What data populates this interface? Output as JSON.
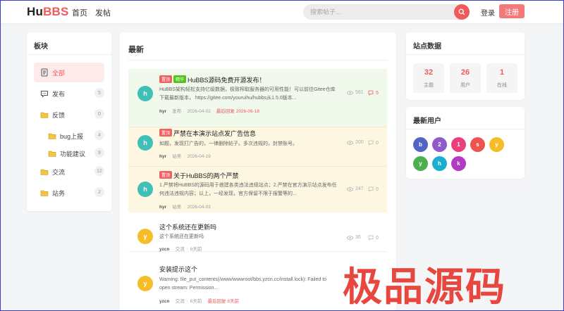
{
  "header": {
    "logo_hu": "Hu",
    "logo_bbs": "BBS",
    "nav": [
      "首页",
      "发帖"
    ],
    "search_placeholder": "搜索帖子...",
    "login": "登录",
    "register": "注册",
    "accent": "#ef5a5a"
  },
  "sidebar": {
    "title": "板块",
    "items": [
      {
        "label": "全部",
        "count": "",
        "active": true,
        "icon": "document-icon"
      },
      {
        "label": "发布",
        "count": "5",
        "icon": "chat-icon"
      },
      {
        "label": "反馈",
        "count": "0",
        "icon": "folder-icon"
      },
      {
        "label": "bug上报",
        "count": "4",
        "icon": "folder-icon"
      },
      {
        "label": "功能建议",
        "count": "9",
        "icon": "folder-icon"
      },
      {
        "label": "交流",
        "count": "12",
        "icon": "folder-icon"
      },
      {
        "label": "站务",
        "count": "2",
        "icon": "folder-icon"
      }
    ]
  },
  "main": {
    "title": "最新",
    "topics": [
      {
        "avatar": "h",
        "avatar_color": "#3fbfb6",
        "bg": "#f0f9ec",
        "tags": [
          {
            "text": "置顶",
            "color": "#f06262"
          },
          {
            "text": "精华",
            "color": "#52c41a"
          }
        ],
        "title": "HuBBS源码免费开源发布！",
        "summary": "HuBBS架构轻松支持亿级数据，极致榨取服务器的可用性能！可以前往Gitee仓库下载最新版本， https://gitee.com/youruihu/hubbs从1.5.0版本...",
        "author": "hyr",
        "board": "发布",
        "date": "2026-04-02",
        "last_reply_label": "最后回复",
        "last_reply": "2026-06-18",
        "views": "561",
        "replies": "5"
      },
      {
        "avatar": "h",
        "avatar_color": "#3fbfb6",
        "bg": "#fdf7e2",
        "tags": [
          {
            "text": "置顶",
            "color": "#f06262"
          }
        ],
        "title": "严禁在本演示站点发广告信息",
        "summary": "如题，发现打广告的，一律删除帖子。多次违规的，封禁账号。",
        "author": "hyr",
        "board": "站务",
        "date": "2026-04-19",
        "last_reply_label": "",
        "last_reply": "",
        "views": "200",
        "replies": "0"
      },
      {
        "avatar": "h",
        "avatar_color": "#3fbfb6",
        "bg": "#fdf7e2",
        "tags": [
          {
            "text": "置顶",
            "color": "#f06262"
          }
        ],
        "title": "关于HuBBS的两个严禁",
        "summary": "1.严禁将HuBBS的源码用于搭建各类违法违规站点；2.严禁在官方演示站点发布任何违法违规内容；以上，一经发现，官方保留不限于报警等的...",
        "author": "hyr",
        "board": "站务",
        "date": "2026-04-03",
        "last_reply_label": "",
        "last_reply": "",
        "views": "247",
        "replies": "0"
      },
      {
        "avatar": "y",
        "avatar_color": "#f5bd27",
        "bg": "#ffffff",
        "tags": [],
        "title": "这个系统还在更新吗",
        "summary": "这个系统还在更新吗",
        "author": "yzcn",
        "board": "交流",
        "date": "6天前",
        "last_reply_label": "",
        "last_reply": "",
        "views": "36",
        "replies": "0"
      },
      {
        "avatar": "y",
        "avatar_color": "#f5bd27",
        "bg": "#ffffff",
        "tags": [],
        "title": "安装提示这个",
        "summary": "Warning: file_put_contents(/www/wwwroot/bbs.yzcn.cc/install.lock): Failed to open stream: Permission...",
        "author": "yzcn",
        "board": "交流",
        "date": "6天前",
        "last_reply_label": "最后回复",
        "last_reply": "6天前",
        "views": "",
        "replies": ""
      }
    ]
  },
  "stats": {
    "title": "站点数据",
    "items": [
      {
        "num": "32",
        "label": "主题"
      },
      {
        "num": "26",
        "label": "用户"
      },
      {
        "num": "1",
        "label": "在线"
      }
    ]
  },
  "users": {
    "title": "最新用户",
    "list": [
      {
        "letter": "b",
        "color": "#5165c4"
      },
      {
        "letter": "2",
        "color": "#8f5bc8"
      },
      {
        "letter": "1",
        "color": "#ea3f7c"
      },
      {
        "letter": "s",
        "color": "#ef5350"
      },
      {
        "letter": "y",
        "color": "#f5bd27"
      },
      {
        "letter": "y",
        "color": "#4caf50"
      },
      {
        "letter": "h",
        "color": "#1aaed1"
      },
      {
        "letter": "k",
        "color": "#b33bc4"
      }
    ]
  },
  "watermark": "极品源码"
}
